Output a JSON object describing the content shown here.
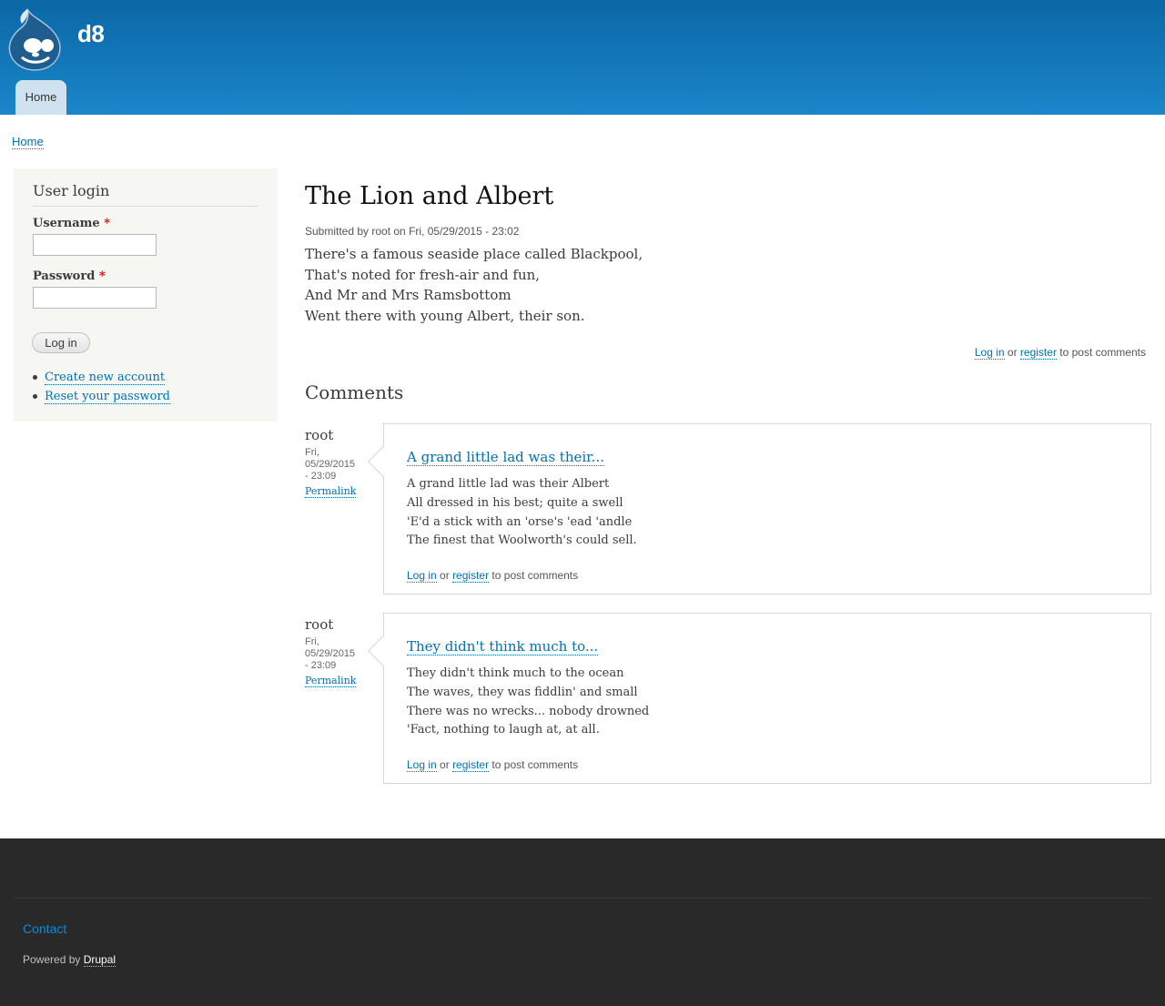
{
  "header": {
    "site_name": "d8",
    "nav": {
      "home_label": "Home"
    }
  },
  "breadcrumb": {
    "home_label": "Home"
  },
  "login_block": {
    "title": "User login",
    "username_label": "Username",
    "password_label": "Password",
    "required_mark": "*",
    "login_button": "Log in",
    "create_account": "Create new account",
    "reset_password": "Reset your password"
  },
  "node": {
    "title": "The Lion and Albert",
    "submitted": "Submitted by root on Fri, 05/29/2015 - 23:02",
    "body": [
      "There's a famous seaside place called Blackpool,",
      "That's noted for fresh-air and fun,",
      "And Mr and Mrs Ramsbottom",
      "Went there with young Albert, their son."
    ],
    "links": {
      "login": "Log in",
      "or": "or",
      "register": "register",
      "suffix": "to post comments"
    }
  },
  "comments": {
    "title": "Comments",
    "items": [
      {
        "author": "root",
        "date_line1": "Fri,",
        "date_line2": "05/29/2015",
        "date_line3": "- 23:09",
        "permalink": "Permalink",
        "title": "A grand little lad was their...",
        "body": [
          "A grand little lad was their Albert",
          "All dressed in his best; quite a swell",
          "'E'd a stick with an 'orse's 'ead 'andle",
          "The finest that Woolworth's could sell."
        ],
        "links": {
          "login": "Log in",
          "or": "or",
          "register": "register",
          "suffix": "to post comments"
        }
      },
      {
        "author": "root",
        "date_line1": "Fri,",
        "date_line2": "05/29/2015",
        "date_line3": "- 23:09",
        "permalink": "Permalink",
        "title": "They didn't think much to...",
        "body": [
          "They didn't think much to the ocean",
          "The waves, they was fiddlin' and small",
          "There was no wrecks... nobody drowned",
          "'Fact, nothing to laugh at, at all."
        ],
        "links": {
          "login": "Log in",
          "or": "or",
          "register": "register",
          "suffix": "to post comments"
        }
      }
    ]
  },
  "footer": {
    "contact": "Contact",
    "powered_prefix": "Powered by",
    "powered_link": "Drupal"
  },
  "colors": {
    "header_top": "#0b67a6",
    "header_bottom": "#1a86c9",
    "link": "#0071b3",
    "footer_bg": "#292929",
    "sidebar_bg": "#f6f6f2"
  },
  "icons": {
    "logo": "drupal-drop-icon",
    "bullet": "bullet-icon"
  }
}
